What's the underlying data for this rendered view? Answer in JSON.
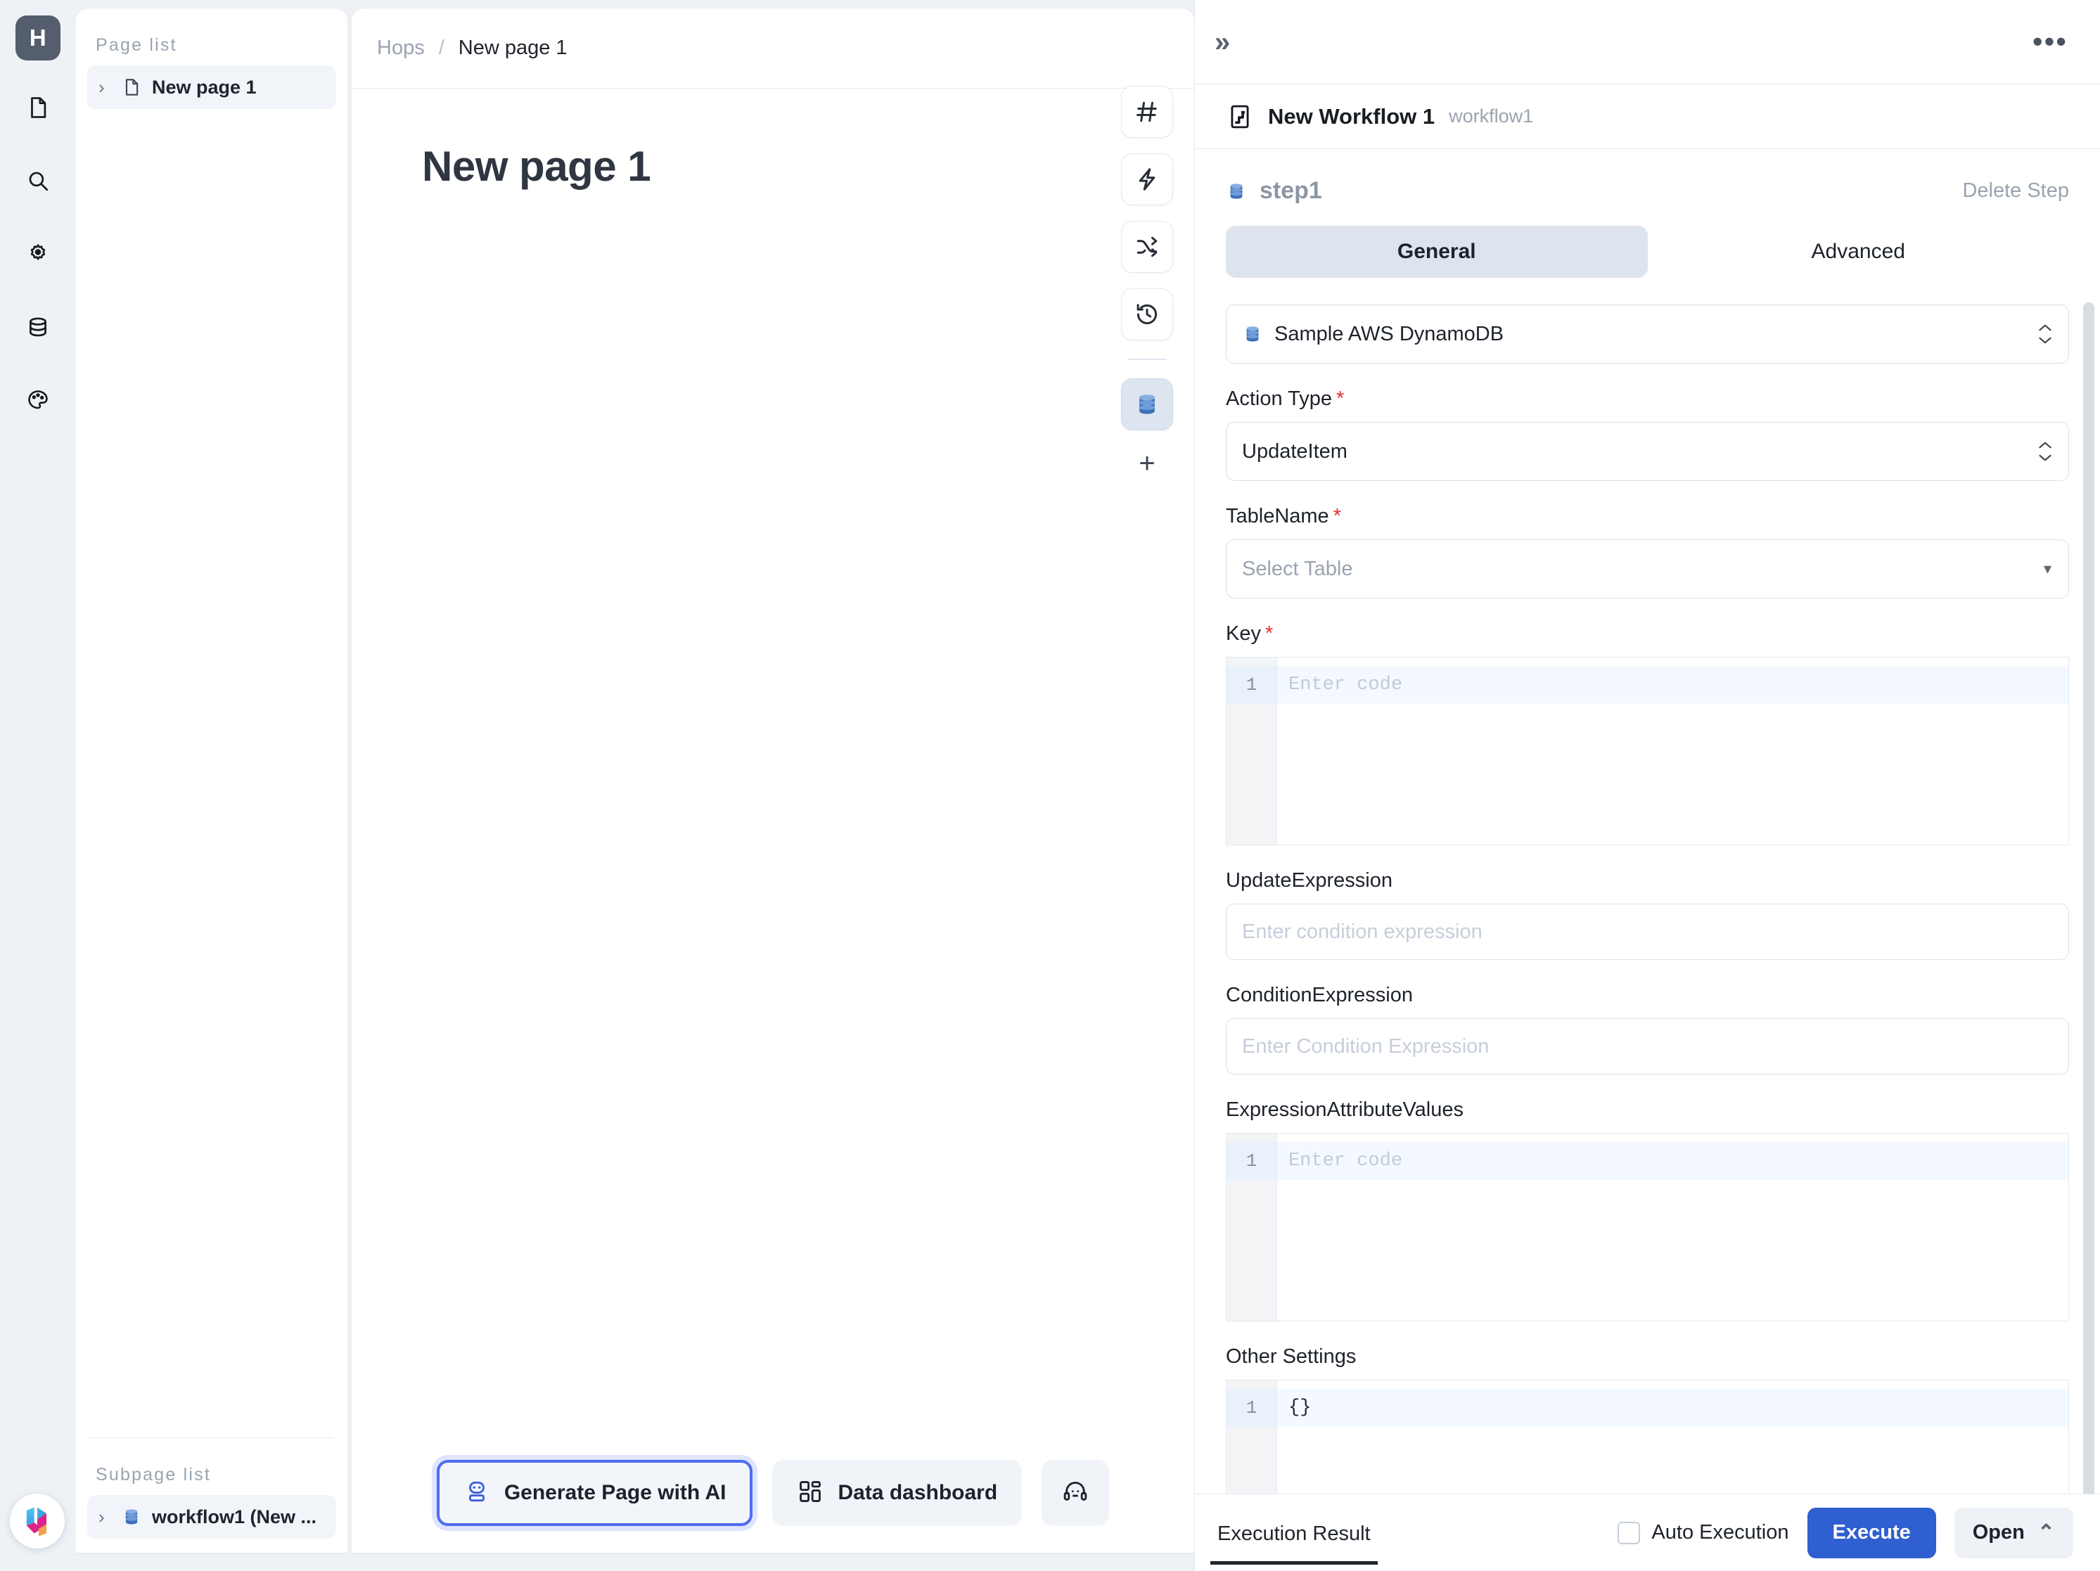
{
  "rail": {
    "logo_label": "H",
    "items": [
      {
        "name": "document-icon",
        "label": "Pages"
      },
      {
        "name": "search-icon",
        "label": "Search"
      },
      {
        "name": "gear-icon",
        "label": "Settings"
      },
      {
        "name": "database-icon",
        "label": "Resources"
      },
      {
        "name": "palette-icon",
        "label": "Theme"
      }
    ],
    "bottom_logo": "hops-logo"
  },
  "pagelist": {
    "page_list_label": "Page list",
    "pages": [
      {
        "label": "New page 1",
        "icon": "file-icon",
        "caret": "›"
      }
    ],
    "subpage_list_label": "Subpage list",
    "subpages": [
      {
        "label": "workflow1 (New ...",
        "icon": "dynamodb-icon",
        "caret": "›"
      }
    ]
  },
  "center": {
    "breadcrumb": {
      "root": "Hops",
      "separator": "/",
      "current": "New page 1"
    },
    "page_title": "New page 1",
    "vtools": [
      {
        "name": "hash-icon"
      },
      {
        "name": "lightning-icon"
      },
      {
        "name": "shuffle-icon"
      },
      {
        "name": "history-icon"
      }
    ],
    "vtool_active": {
      "name": "database-icon"
    },
    "vtool_add": "+",
    "bottom_buttons": [
      {
        "label": "Generate Page with AI",
        "icon": "robot-icon",
        "primary": true
      },
      {
        "label": "Data dashboard",
        "icon": "dashboard-icon",
        "primary": false
      },
      {
        "label": "",
        "icon": "headset-icon",
        "primary": false
      }
    ]
  },
  "workflow": {
    "collapse_icon": "»",
    "more_icon": "•••",
    "title": "New Workflow 1",
    "slug": "workflow1",
    "icon": "workflow-icon",
    "step": {
      "name": "step1",
      "icon": "dynamodb-icon",
      "delete_label": "Delete Step"
    },
    "tabs": [
      {
        "label": "General",
        "active": true
      },
      {
        "label": "Advanced",
        "active": false
      }
    ],
    "resource": {
      "value": "Sample AWS DynamoDB",
      "icon": "dynamodb-icon"
    },
    "fields": [
      {
        "key": "action_type",
        "label": "Action Type",
        "required": true,
        "type": "select-spinner",
        "value": "UpdateItem"
      },
      {
        "key": "table_name",
        "label": "TableName",
        "required": true,
        "type": "select-caret",
        "placeholder": "Select Table",
        "value": ""
      },
      {
        "key": "key",
        "label": "Key",
        "required": true,
        "type": "code",
        "placeholder": "Enter code",
        "value": "",
        "line_number": "1",
        "size": "tall"
      },
      {
        "key": "update_expression",
        "label": "UpdateExpression",
        "required": false,
        "type": "text",
        "placeholder": "Enter condition expression",
        "value": ""
      },
      {
        "key": "condition_expression",
        "label": "ConditionExpression",
        "required": false,
        "type": "text",
        "placeholder": "Enter Condition Expression",
        "value": ""
      },
      {
        "key": "expression_attribute_values",
        "label": "ExpressionAttributeValues",
        "required": false,
        "type": "code",
        "placeholder": "Enter code",
        "value": "",
        "line_number": "1",
        "size": "tall"
      },
      {
        "key": "other_settings",
        "label": "Other Settings",
        "required": false,
        "type": "code",
        "placeholder": "",
        "value": "{}",
        "line_number": "1",
        "size": "short"
      }
    ],
    "execbar": {
      "result_tab_label": "Execution Result",
      "auto_execution_label": "Auto Execution",
      "auto_execution_checked": false,
      "execute_label": "Execute",
      "open_label": "Open",
      "open_caret": "⌃"
    }
  },
  "colors": {
    "accent": "#2f5fd0",
    "primary_outline": "#4f6cf0",
    "required": "#e03131",
    "rail_bg": "#eef1f6",
    "panel_bg": "#ffffff"
  }
}
